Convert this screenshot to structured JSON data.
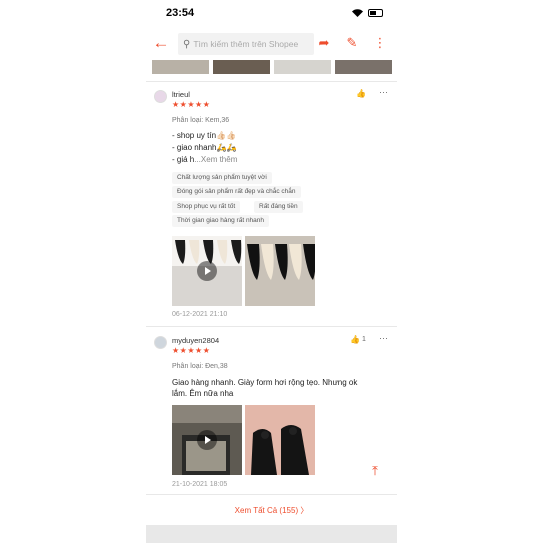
{
  "status_bar": {
    "time": "23:54"
  },
  "search": {
    "placeholder": "Tìm kiếm thêm trên Shopee"
  },
  "icons": {
    "back": "arrow-left-icon",
    "share": "share-icon",
    "edit": "edit-icon",
    "more": "more-vertical-icon"
  },
  "reviews": [
    {
      "username": "ltrieul",
      "stars": "★★★★★",
      "variant": "Phân loại: Kem,36",
      "comment_lines": [
        "- shop uy tín👍🏻👍🏻",
        "- giao nhanh🛵🛵",
        "- giá h"
      ],
      "see_more": "...Xem thêm",
      "tags": [
        "Chất lượng sản phẩm tuyệt vời",
        "Đóng gói sản phẩm rất đẹp và chắc chắn",
        "Shop phục vụ rất tốt",
        "Rất đáng tiền",
        "Thời gian giao hàng rất nhanh"
      ],
      "date": "06-12-2021 21:10"
    },
    {
      "username": "myduyen2804",
      "stars": "★★★★★",
      "variant": "Phân loại: Đen,38",
      "likes": "1",
      "comment": "Giao hàng nhanh. Giày form hơi rộng tẹo. Nhưng ok lắm. Êm nữa nha",
      "date": "21-10-2021 18:05"
    }
  ],
  "see_all": "Xem Tất Cả (155)  〉",
  "colors": {
    "accent": "#ee4d2d"
  }
}
